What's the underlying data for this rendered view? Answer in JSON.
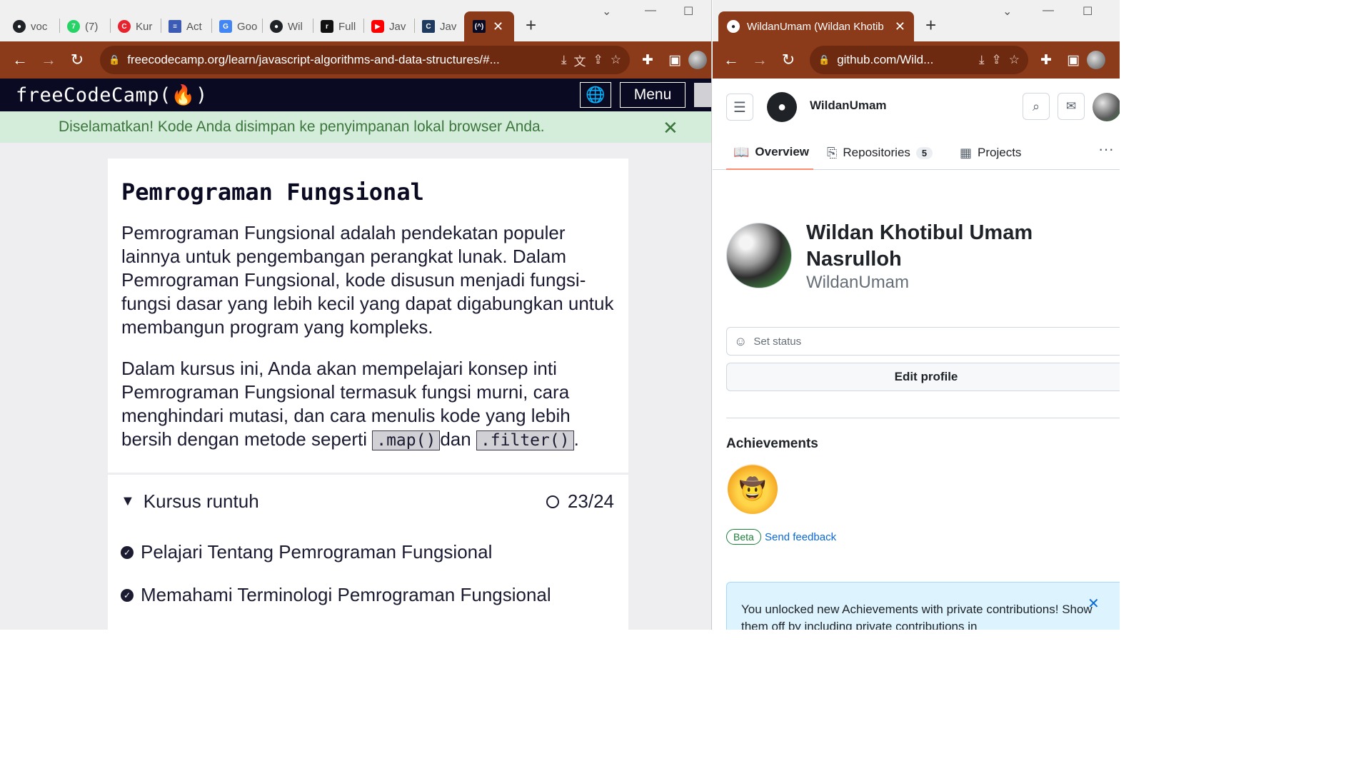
{
  "left_window": {
    "tabs": [
      {
        "label": "voc",
        "icon": "github-icon"
      },
      {
        "label": "(7)",
        "icon": "whatsapp-icon"
      },
      {
        "label": "Kur",
        "icon": "codecademy-icon"
      },
      {
        "label": "Act",
        "icon": "flag-icon"
      },
      {
        "label": "Goo",
        "icon": "google-translate-icon"
      },
      {
        "label": "Wil",
        "icon": "github-icon"
      },
      {
        "label": "Full",
        "icon": "r-icon"
      },
      {
        "label": "Jav",
        "icon": "youtube-icon"
      },
      {
        "label": "Jav",
        "icon": "c-icon"
      }
    ],
    "active_tab_icon": "freecodecamp-icon",
    "url": "freecodecamp.org/learn/javascript-algorithms-and-data-structures/#..."
  },
  "fcc": {
    "logo": "freeCodeCamp(🔥)",
    "menu_label": "Menu",
    "flash_message": "Diselamatkan! Kode Anda disimpan ke penyimpanan lokal browser Anda.",
    "title": "Pemrograman Fungsional",
    "paragraph1": "Pemrograman Fungsional adalah pendekatan populer lainnya untuk pengembangan perangkat lunak. Dalam Pemrograman Fungsional, kode disusun menjadi fungsi-fungsi dasar yang lebih kecil yang dapat digabungkan untuk membangun program yang kompleks.",
    "paragraph2_start": "Dalam kursus ini, Anda akan mempelajari konsep inti Pemrograman Fungsional termasuk fungsi murni, cara menghindari mutasi, dan cara menulis kode yang lebih bersih dengan metode seperti ",
    "code1": ".map()",
    "paragraph2_mid": "dan ",
    "code2": ".filter()",
    "paragraph2_end": ".",
    "course_toggle": "Kursus runtuh",
    "progress": "23/24",
    "lessons": [
      "Pelajari Tentang Pemrograman Fungsional",
      "Memahami Terminologi Pemrograman Fungsional"
    ]
  },
  "right_window": {
    "tab_title": "WildanUmam (Wildan Khotib",
    "url": "github.com/Wild..."
  },
  "github": {
    "username": "WildanUmam",
    "tabs": {
      "overview": "Overview",
      "repositories": "Repositories",
      "repositories_count": "5",
      "projects": "Projects"
    },
    "full_name": "Wildan Khotibul Umam Nasrulloh",
    "login": "WildanUmam",
    "set_status": "Set status",
    "edit_profile": "Edit profile",
    "achievements_title": "Achievements",
    "beta": "Beta",
    "send_feedback": "Send feedback",
    "flash": "You unlocked new Achievements with private contributions! Show them off by including private contributions in"
  },
  "colors": {
    "chrome_toolbar": "#8b3a1a",
    "fcc_nav": "#0a0a23",
    "fcc_flash_bg": "#d4edda",
    "gh_tab_underline": "#fd8c73",
    "gh_link": "#0969da"
  }
}
